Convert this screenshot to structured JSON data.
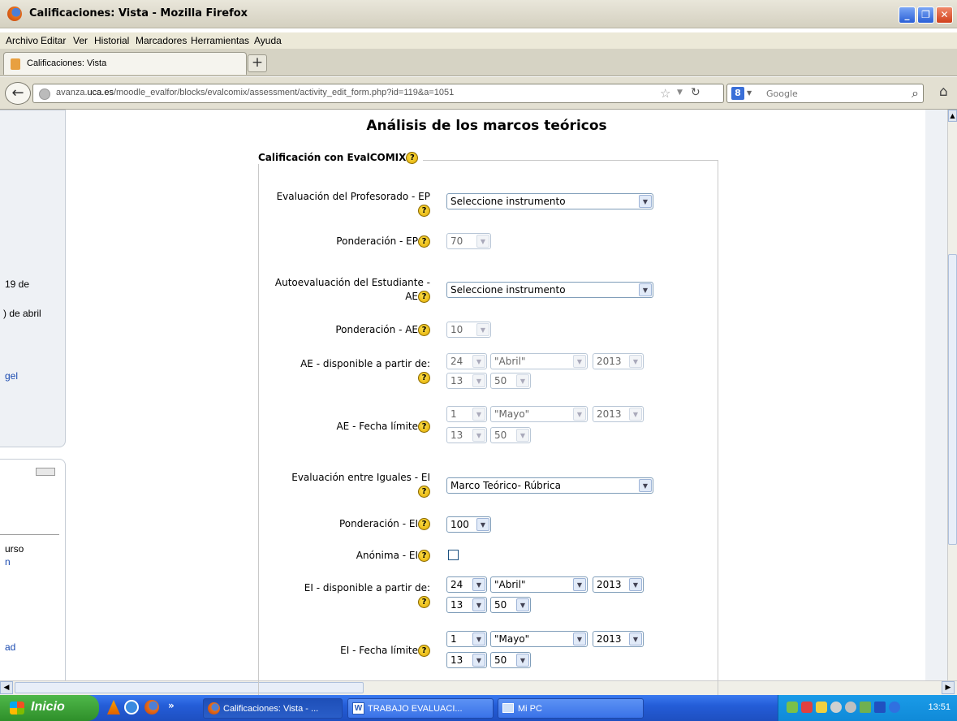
{
  "window": {
    "title": "Calificaciones: Vista - Mozilla Firefox",
    "minimize": "_",
    "maximize": "❐",
    "close": "✕"
  },
  "menu": [
    "Archivo",
    "Editar",
    "Ver",
    "Historial",
    "Marcadores",
    "Herramientas",
    "Ayuda"
  ],
  "tab": {
    "label": "Calificaciones: Vista",
    "new_tab": "+"
  },
  "nav": {
    "url_pre": "avanza.",
    "url_domain": "uca.es",
    "url_post": "/moodle_evalfor/blocks/evalcomix/assessment/activity_edit_form.php?id=119&a=1051",
    "search_placeholder": "Google"
  },
  "sidebar": {
    "frag_1": "19 de",
    "frag_2": ") de abril",
    "frag_3": "gel",
    "frag_4": "urso",
    "frag_5": "n",
    "frag_6": "ad"
  },
  "page": {
    "heading": "Análisis de los marcos teóricos",
    "legend": "Calificación con EvalCOMIX",
    "help_glyph": "?"
  },
  "form": {
    "ep_label": "Evaluación del Profesorado - EP",
    "ep_select": "Seleccione instrumento",
    "ep_weight_label": "Ponderación - EP",
    "ep_weight": "70",
    "ae_label": "Autoevaluación del Estudiante - AE",
    "ae_select": "Seleccione instrumento",
    "ae_weight_label": "Ponderación - AE",
    "ae_weight": "10",
    "ae_avail_label": "AE - disponible a partir de:",
    "ae_avail": {
      "day": "24",
      "month": "\"Abril\"",
      "year": "2013",
      "hour": "13",
      "minute": "50"
    },
    "ae_deadline_label": "AE - Fecha límite",
    "ae_deadline": {
      "day": "1",
      "month": "\"Mayo\"",
      "year": "2013",
      "hour": "13",
      "minute": "50"
    },
    "ei_label": "Evaluación entre Iguales - EI",
    "ei_select": "Marco Teórico- Rúbrica",
    "ei_weight_label": "Ponderación - EI",
    "ei_weight": "100",
    "ei_anon_label": "Anónima - EI",
    "ei_avail_label": "EI - disponible a partir de:",
    "ei_avail": {
      "day": "24",
      "month": "\"Abril\"",
      "year": "2013",
      "hour": "13",
      "minute": "50"
    },
    "ei_deadline_label": "EI - Fecha límite",
    "ei_deadline": {
      "day": "1",
      "month": "\"Mayo\"",
      "year": "2013",
      "hour": "13",
      "minute": "50"
    }
  },
  "taskbar": {
    "start": "Inicio",
    "tasks": [
      "Calificaciones: Vista - ...",
      "TRABAJO EVALUACI...",
      "Mi PC"
    ],
    "clock": "13:51"
  }
}
